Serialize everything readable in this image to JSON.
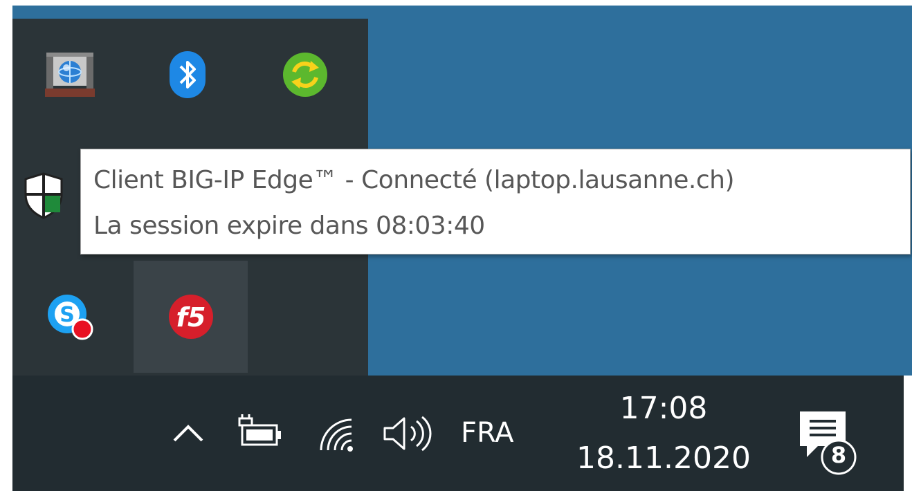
{
  "tooltip": {
    "line1": "Client BIG-IP Edge™ - Connecté (laptop.lausanne.ch)",
    "line2": "La session expire dans 08:03:40"
  },
  "taskbar": {
    "chevron_glyph": "^",
    "language": "FRA",
    "time": "17:08",
    "date": "18.11.2020",
    "notification_count": "8"
  },
  "tray_icons": [
    {
      "id": "network-globe",
      "icon": "network-globe-icon"
    },
    {
      "id": "bluetooth",
      "icon": "bluetooth-icon"
    },
    {
      "id": "sync",
      "icon": "sync-icon"
    },
    {
      "id": "defender",
      "icon": "shield-icon"
    },
    {
      "id": "skype",
      "icon": "skype-icon"
    },
    {
      "id": "f5",
      "icon": "f5-icon"
    }
  ],
  "colors": {
    "desktop": "#2e6f9c",
    "tray_overflow": "#2b3438",
    "taskbar": "#222c31",
    "bluetooth": "#1e88e5",
    "sync": "#5cb82e",
    "skype": "#1da1f2",
    "f5": "#d61f2b",
    "status_dot": "#e81123"
  }
}
